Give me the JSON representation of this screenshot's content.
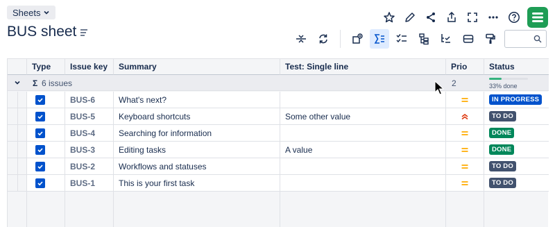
{
  "header": {
    "sheets_label": "Sheets",
    "title": "BUS sheet"
  },
  "top_icons": [
    "star-icon",
    "pencil-icon",
    "share-icon",
    "export-icon",
    "fullscreen-icon",
    "more-icon",
    "help-icon",
    "app-logo-icon"
  ],
  "toolbar": {
    "icons": [
      "collapse-rows-icon",
      "refresh-icon",
      "add-view-icon",
      "sum-icon",
      "checklist-icon",
      "hierarchy-icon",
      "sort-tree-icon",
      "card-icon",
      "format-painter-icon"
    ],
    "search_placeholder": ""
  },
  "columns": [
    "Type",
    "Issue key",
    "Summary",
    "Test: Single line",
    "Prio",
    "Status"
  ],
  "group": {
    "sigma": "Σ",
    "label": "6 issues",
    "prio_count": "2",
    "progress_fraction": 0.33,
    "progress_label": "33% done"
  },
  "rows": [
    {
      "key": "BUS-6",
      "summary": "What's next?",
      "test": "",
      "prio": "medium",
      "status": "IN PROGRESS"
    },
    {
      "key": "BUS-5",
      "summary": "Keyboard shortcuts",
      "test": "Some other value",
      "prio": "highest",
      "status": "TO DO"
    },
    {
      "key": "BUS-4",
      "summary": "Searching for information",
      "test": "",
      "prio": "medium",
      "status": "DONE"
    },
    {
      "key": "BUS-3",
      "summary": "Editing tasks",
      "test": "A value",
      "prio": "medium",
      "status": "DONE"
    },
    {
      "key": "BUS-2",
      "summary": "Workflows and statuses",
      "test": "",
      "prio": "medium",
      "status": "TO DO"
    },
    {
      "key": "BUS-1",
      "summary": "This is your first task",
      "test": "",
      "prio": "medium",
      "status": "TO DO"
    }
  ],
  "colors": {
    "in_progress": "#0052cc",
    "to_do": "#42526e",
    "done": "#00875a",
    "prio_medium": "#ffab00",
    "prio_highest": "#de350b",
    "checkbox": "#0052cc",
    "app_logo": "#1f9d55"
  }
}
